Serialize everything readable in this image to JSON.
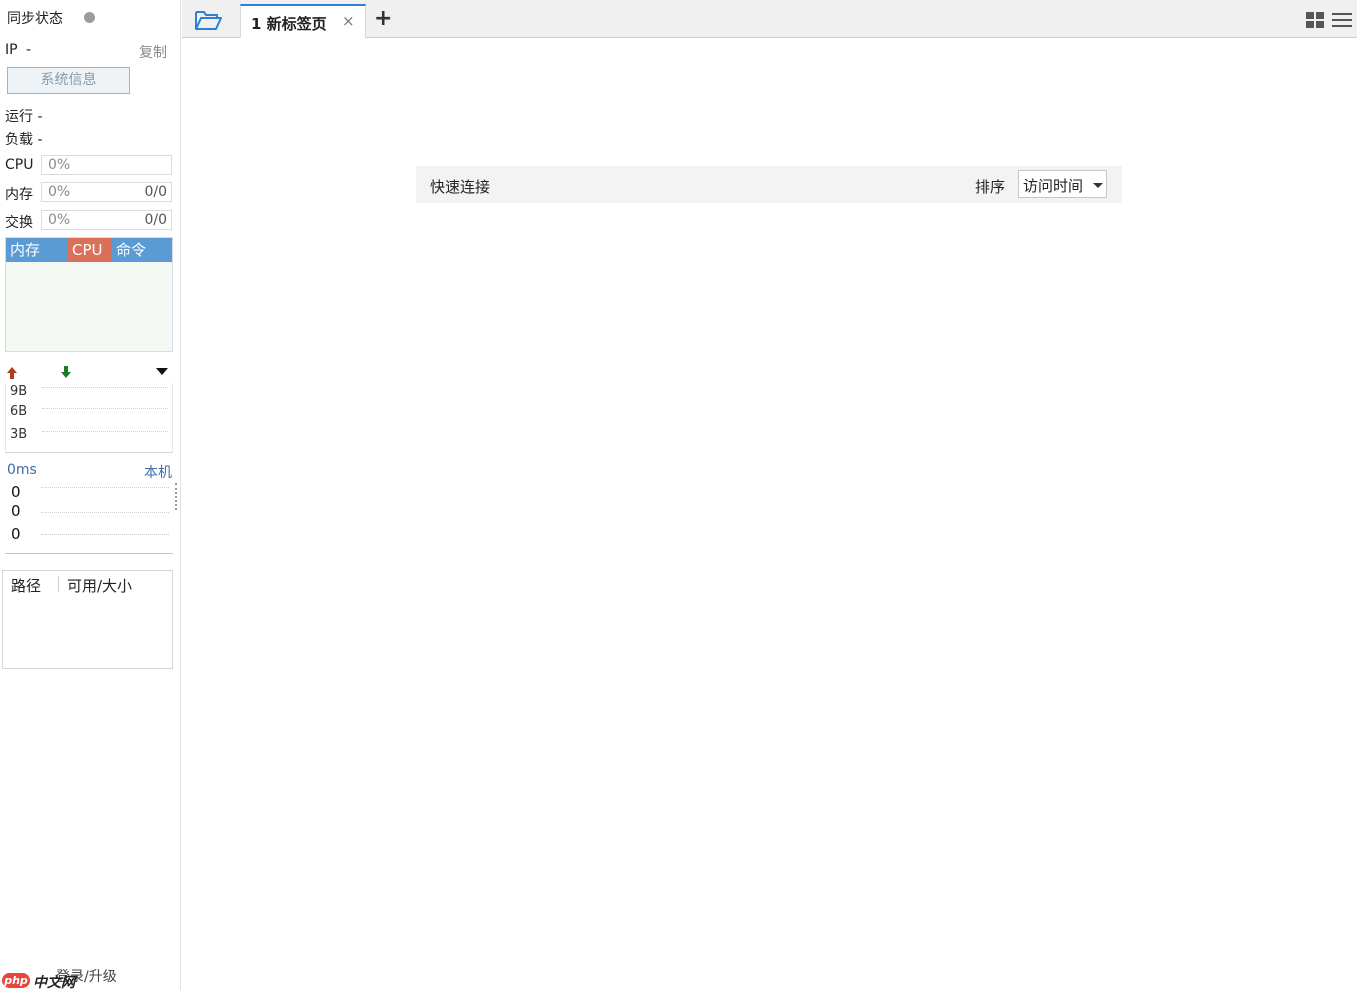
{
  "sidebar": {
    "sync_title": "同步状态",
    "ip_label": "IP",
    "ip_value": "-",
    "copy_label": "复制",
    "sysinfo_button": "系统信息",
    "run_label": "运行 -",
    "load_label": "负载 -",
    "meters": [
      {
        "label": "CPU",
        "percent": "0%",
        "ratio": ""
      },
      {
        "label": "内存",
        "percent": "0%",
        "ratio": "0/0"
      },
      {
        "label": "交换",
        "percent": "0%",
        "ratio": "0/0"
      }
    ],
    "process_table": {
      "columns": [
        "内存",
        "CPU",
        "命令"
      ],
      "colors": {
        "mem": "#5b9bd5",
        "cpu": "#d9705a",
        "cmd": "#5b9bd5"
      }
    },
    "network": {
      "upload_icon": "arrow-up-icon",
      "download_icon": "arrow-down-icon",
      "ticks": [
        "9B",
        "6B",
        "3B"
      ]
    },
    "ping": {
      "latency": "0ms",
      "host": "本机",
      "values": [
        "0",
        "0",
        "0"
      ]
    },
    "disk_table": {
      "columns": [
        "路径",
        "可用/大小"
      ]
    },
    "login_link": "登录/升级",
    "watermark": {
      "pill": "php",
      "text": "中文网"
    }
  },
  "tabbar": {
    "folder_icon": "folder-open-icon",
    "tabs": [
      {
        "title": "1 新标签页",
        "close": "×"
      }
    ],
    "add_tab": "+",
    "grid_icon": "grid-icon",
    "menu_icon": "hamburger-menu-icon"
  },
  "main": {
    "quick_connect_title": "快速连接",
    "sort_label": "排序",
    "sort_value": "访问时间"
  },
  "colors": {
    "accent": "#2f7fd6",
    "status_dot": "#9c9c9c",
    "upload_arrow": "#b03a1a",
    "download_arrow": "#1f7a2a",
    "link": "#3a6ea5"
  }
}
